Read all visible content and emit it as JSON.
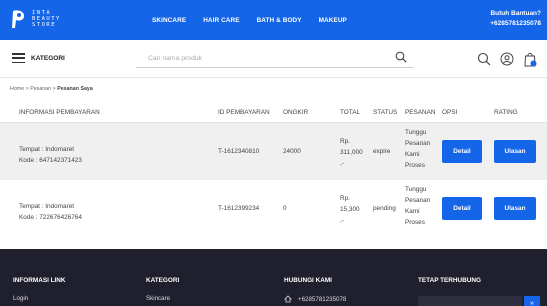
{
  "brand": {
    "logo_lines": [
      "INTA",
      "BEAUTY",
      "STORE"
    ],
    "accent_color": "#1565e8",
    "footer_color": "#1f1f2d"
  },
  "nav": {
    "items": [
      "SKINCARE",
      "HAIR CARE",
      "BATH & BODY",
      "MAKEUP"
    ]
  },
  "help": {
    "title": "Butuh Bantuan?",
    "phone": "+6285781235078"
  },
  "search": {
    "kategori_label": "KATEGORI",
    "placeholder": "Cari nama produk",
    "value": ""
  },
  "icons": {
    "menu": "hamburger-icon",
    "search": "search-icon",
    "account": "user-circle-icon",
    "cart": "shopping-bag-icon",
    "cart_count": "0"
  },
  "breadcrumb": {
    "home": "Home",
    "sep": ">",
    "pesanan": "Pesanan",
    "current": "Pesanan Saya"
  },
  "table": {
    "headers": {
      "info": "INFORMASI PEMBAYARAN",
      "id": "ID PEMBAYARAN",
      "ongkir": "ONGKIR",
      "total": "TOTAL",
      "status": "STATUS",
      "pesanan": "PESANAN",
      "opsi": "OPSI",
      "rating": "RATING"
    },
    "rows": [
      {
        "tempat": "Tempat : Indomaret",
        "kode": "Kode : 647142371423",
        "id": "T-1612340810",
        "ongkir": "24000",
        "total_line1": "Rp.",
        "total_line2": "311,000",
        "total_line3": ",-",
        "status": "expire",
        "pesanan_lines": [
          "Tunggu",
          "Pesanan",
          "Kami",
          "Proses"
        ],
        "detail_label": "Detail",
        "ulasan_label": "Ulasan"
      },
      {
        "tempat": "Tempat : Indomaret",
        "kode": "Kode : 722676426764",
        "id": "T-1612399234",
        "ongkir": "0",
        "total_line1": "Rp.",
        "total_line2": "15,300",
        "total_line3": ",-",
        "status": "pending",
        "pesanan_lines": [
          "Tunggu",
          "Pesanan",
          "Kami",
          "Proses"
        ],
        "detail_label": "Detail",
        "ulasan_label": "Ulasan"
      }
    ]
  },
  "footer": {
    "col1_title": "INFORMASI LINK",
    "col1_item": "Login",
    "col2_title": "KATEGORI",
    "col2_item": "Skincare",
    "col3_title": "HUBUNGI KAMI",
    "col3_phone": "+6285781235078",
    "col4_title": "TETAP TERHUBUNG",
    "newsletter_button": "»"
  }
}
